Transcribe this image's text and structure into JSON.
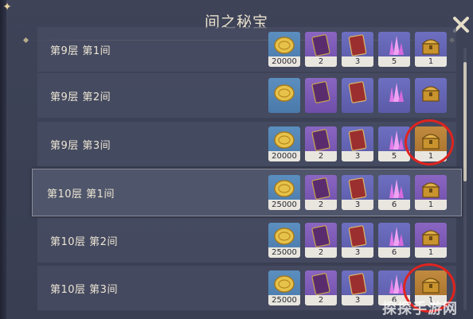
{
  "window": {
    "title": "间之秘宝",
    "close_icon": "close-icon",
    "corner_icon": "star-icon"
  },
  "rows": [
    {
      "label": "第9层 第1间",
      "rewards": [
        "20000",
        "2",
        "3",
        "5",
        "1"
      ]
    },
    {
      "label": "第9层 第2间",
      "rewards": [
        "",
        "",
        "",
        "",
        ""
      ]
    },
    {
      "label": "第9层 第3间",
      "rewards": [
        "20000",
        "2",
        "3",
        "5",
        "1"
      ]
    },
    {
      "label": "第10层 第1间",
      "rewards": [
        "25000",
        "2",
        "3",
        "6",
        "1"
      ]
    },
    {
      "label": "第10层 第2间",
      "rewards": [
        "25000",
        "2",
        "3",
        "6",
        "1"
      ]
    },
    {
      "label": "第10层 第3间",
      "rewards": [
        "25000",
        "2",
        "3",
        "6",
        "1"
      ]
    }
  ],
  "reward_icons": [
    "gold-coin-icon",
    "purple-book-icon",
    "red-book-icon",
    "crystal-icon",
    "treasure-chest-icon"
  ],
  "colors": {
    "highlight": "#e0231f",
    "selected_border": "#8a8c9a"
  },
  "watermark": "探探手游网"
}
